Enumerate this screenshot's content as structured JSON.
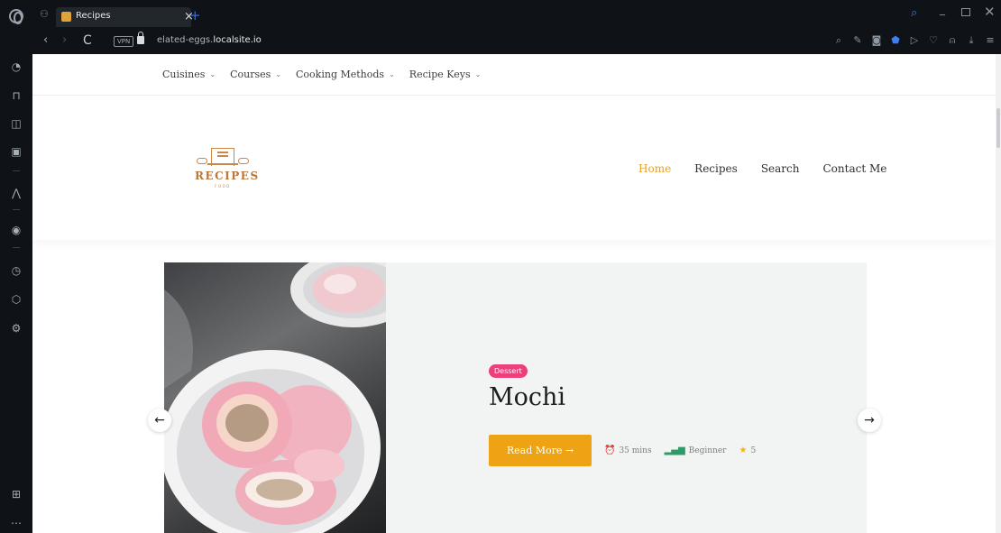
{
  "browser": {
    "tab_title": "Recipes",
    "tab_close": "×",
    "new_tab": "+",
    "url_prefix": "elated-eggs.",
    "url_domain": "localsite.io",
    "vpn_label": "VPN",
    "back": "‹",
    "forward": "›",
    "reload": "C",
    "icons": [
      "search-icon",
      "snapshot-icon",
      "camera-icon",
      "shield-icon",
      "play-icon",
      "heart-icon",
      "account-icon",
      "download-icon",
      "settings-icon"
    ],
    "sidebar_icons": [
      "speed-dial-icon",
      "shopping-icon",
      "twitch-icon",
      "wallet-icon",
      "aria-icon",
      "player-icon",
      "history-icon",
      "extensions-icon",
      "settings-icon",
      "workspaces-icon",
      "more-icon"
    ],
    "accent": "#3d7ff2"
  },
  "topnav": {
    "items": [
      {
        "label": "Cuisines"
      },
      {
        "label": "Courses"
      },
      {
        "label": "Cooking Methods"
      },
      {
        "label": "Recipe Keys"
      }
    ]
  },
  "header": {
    "logo_text": "RECIPES",
    "logo_sub": "FOOD",
    "nav": [
      {
        "label": "Home",
        "active": true
      },
      {
        "label": "Recipes"
      },
      {
        "label": "Search"
      },
      {
        "label": "Contact Me"
      }
    ],
    "active_color": "#eb9f1e"
  },
  "slide": {
    "badge": "Dessert",
    "title": "Mochi",
    "read_more": "Read More →",
    "time": "35 mins",
    "difficulty": "Beginner",
    "rating": "5",
    "badge_color": "#ec3f7b",
    "button_color": "#eda313",
    "prev": "←",
    "next": "→"
  }
}
